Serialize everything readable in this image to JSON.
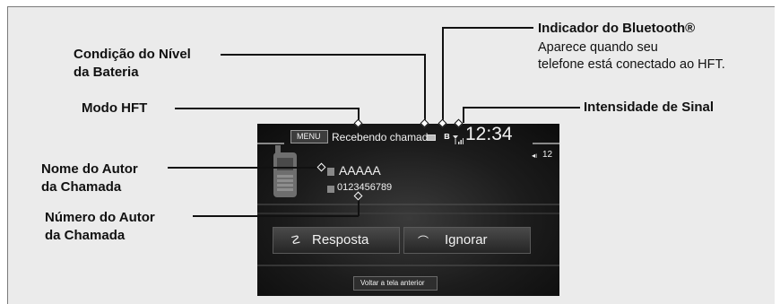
{
  "labels": {
    "bateria": "Condição do Nível\nda Bateria",
    "modo": "Modo HFT",
    "nome": "Nome do Autor\nda Chamada",
    "numero": "Número do Autor\nda Chamada",
    "bluetooth": "Indicador do Bluetooth®",
    "bluetooth_desc": "Aparece quando seu\ntelefone está conectado ao HFT.",
    "sinal": "Intensidade de Sinal"
  },
  "screen": {
    "menu": "MENU",
    "status": "Recebendo chamada",
    "time": "12:34",
    "volume": "12",
    "caller_name": "AAAAA",
    "caller_number": "0123456789",
    "answer": "Resposta",
    "ignore": "Ignorar",
    "back": "Voltar a tela anterior"
  }
}
